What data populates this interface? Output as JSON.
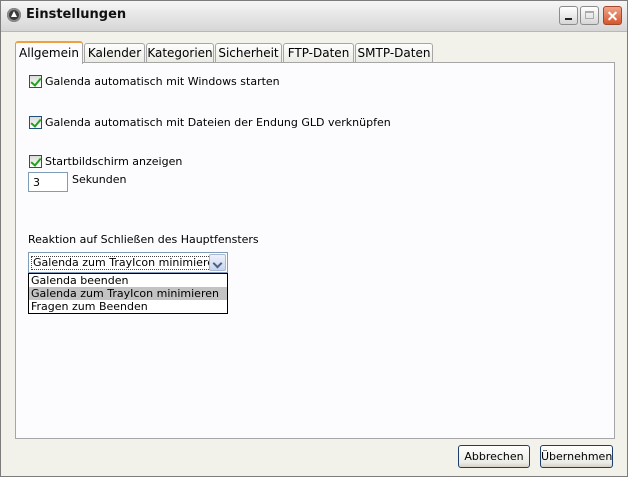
{
  "window": {
    "title": "Einstellungen"
  },
  "tabs": [
    {
      "label": "Allgemein",
      "active": true
    },
    {
      "label": "Kalender"
    },
    {
      "label": "Kategorien"
    },
    {
      "label": "Sicherheit"
    },
    {
      "label": "FTP-Daten"
    },
    {
      "label": "SMTP-Daten"
    }
  ],
  "general": {
    "autostart": {
      "label": "Galenda automatisch mit Windows starten",
      "checked": true
    },
    "associate": {
      "label": "Galenda automatisch mit Dateien der Endung GLD verknüpfen",
      "checked": true
    },
    "splash": {
      "label": "Startbildschirm anzeigen",
      "checked": true
    },
    "splash_seconds": {
      "value": "3",
      "unit_label": "Sekunden"
    },
    "close_reaction": {
      "label": "Reaktion auf Schließen des Hauptfensters",
      "selected": "Galenda zum TrayIcon minimieren",
      "options": [
        "Galenda beenden",
        "Galenda zum TrayIcon minimieren",
        "Fragen zum Beenden"
      ]
    }
  },
  "buttons": {
    "cancel": "Abbrechen",
    "apply": "Übernehmen"
  },
  "colors": {
    "tab_highlight": "#f0a040",
    "check_mark": "#21a121",
    "selected_option": "#c3c3c3"
  }
}
